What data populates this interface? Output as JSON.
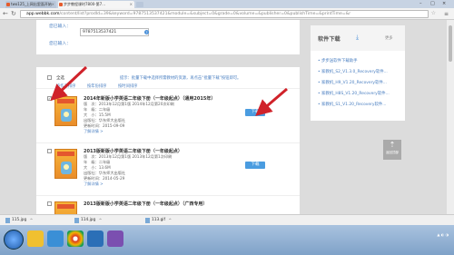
{
  "browser": {
    "tabs": [
      {
        "label": "two125_上网出里面开始",
        "active": false
      },
      {
        "label": "步步教程课时7800-第7...",
        "active": true
      }
    ],
    "url_domain": "app.webbk.com",
    "url_rest": "/content/list?prodId=39&keyword=9787513537421&module=&subject=0&grade=0&volume=&publisher=0&publishTime=&printTime=&r"
  },
  "search": {
    "label_top": "您已输入：",
    "value": "9787513537421",
    "label_bottom": "您已输入："
  },
  "results": {
    "select_all_label": "全选",
    "tip": "提示：批量下载中选择所需教材的资源，再点击“批量下载”按钮即可。",
    "sort": [
      "按作者排序",
      "按年份排序",
      "按时间排序"
    ],
    "items": [
      {
        "title": "2014年新版小学英语二年级下册（一年级起点）（通用2015年）",
        "edition": "版　次：2013年12月第1版 2014年12月第20次印刷",
        "grade": "年　级：二年级",
        "size": "大　小：15.5M",
        "publisher": "出版社：华东师大出版社",
        "updated": "更新时间：2015-09-09",
        "more": "了解详情 >",
        "download": "下载",
        "checked": true
      },
      {
        "title": "2013版新版小学英语二年级下册（一年级起点）",
        "edition": "版　次：2013年12月第1版 2013年12月第1次印刷",
        "grade": "年　级：二年级",
        "size": "大　小：13.6M",
        "publisher": "出版社：华东师大出版社",
        "updated": "更新时间：2014-05-29",
        "more": "了解详情 >",
        "download": "下载",
        "checked": false
      },
      {
        "title": "2013版新版小学英语二年级下册（一年级起点）（广西专用）",
        "edition": "",
        "grade": "",
        "size": "",
        "publisher": "",
        "updated": "",
        "more": "",
        "download": "",
        "checked": false
      }
    ]
  },
  "sidebar": {
    "title": "软件下载",
    "more": "更多",
    "items": [
      "• 步步送软件下载助手",
      "• 家教机_S2_V1.3.0_Recovery软件...",
      "• 家教机_H9_V1.20_Recovery软件...",
      "• 家教机_H8S_V1.20_Recovery软件...",
      "• 家教机_S1_V1.20_Recovery软件..."
    ]
  },
  "backtop": {
    "label": "返回顶部"
  },
  "downloads": [
    {
      "name": "115.jpg"
    },
    {
      "name": "114.jpg"
    },
    {
      "name": "113.gif"
    }
  ],
  "colors": {
    "link": "#4a7fc1",
    "button": "#4a9ce0",
    "arrow": "#d0222a"
  }
}
